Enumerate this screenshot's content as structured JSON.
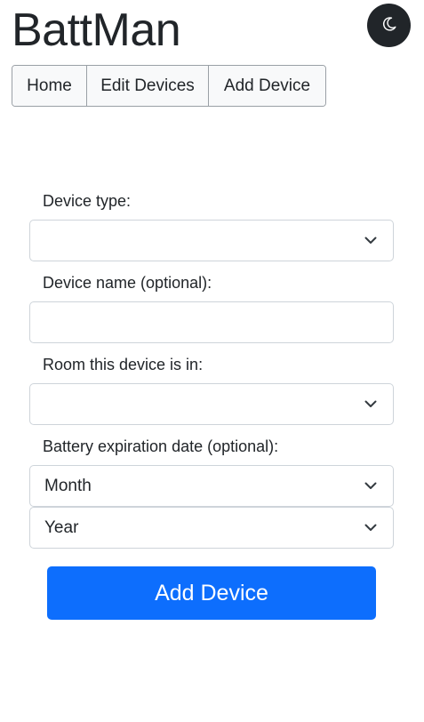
{
  "app": {
    "title": "BattMan"
  },
  "header": {
    "theme_toggle_icon": "moon-icon"
  },
  "nav": {
    "items": [
      {
        "label": "Home"
      },
      {
        "label": "Edit Devices"
      },
      {
        "label": "Add Device"
      }
    ]
  },
  "form": {
    "device_type": {
      "label": "Device type:",
      "value": ""
    },
    "device_name": {
      "label": "Device name (optional):",
      "value": "",
      "placeholder": ""
    },
    "room": {
      "label": "Room this device is in:",
      "value": ""
    },
    "battery_expiration": {
      "label": "Battery expiration date (optional):",
      "month_value": "Month",
      "year_value": "Year"
    },
    "submit_label": "Add Device"
  },
  "colors": {
    "primary": "#0d6efd",
    "dark": "#212529",
    "nav_bg": "#f8f9fa",
    "border": "#ced4da"
  }
}
